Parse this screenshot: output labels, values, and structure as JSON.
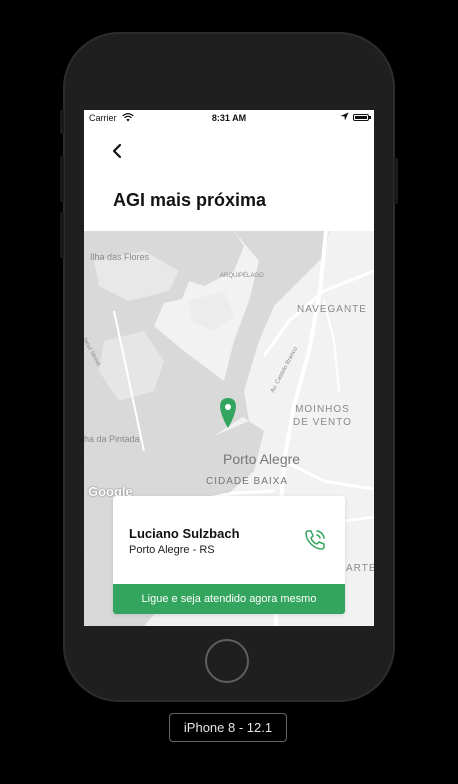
{
  "status_bar": {
    "carrier": "Carrier",
    "time": "8:31 AM"
  },
  "header": {
    "title": "AGI mais próxima"
  },
  "map": {
    "labels": {
      "ilha_das_flores": "Ilha das Flores",
      "arquipelago": "ARQUIPÉLAGO",
      "navegantes": "NAVEGANTE",
      "jacui_street": "Jacuí Street",
      "castelo_branco": "Av. Castelo Branco",
      "moinhos": "MOINHOS\nDE VENTO",
      "pintada": "ha da Pintada",
      "porto_alegre": "Porto Alegre",
      "cidade_baixa": "CIDADE BAIXA",
      "partial": "ARTE"
    },
    "attribution": "Google",
    "colors": {
      "water": "#d8d8d8",
      "land": "#f2f2f2",
      "pin": "#34a55e"
    }
  },
  "agent_card": {
    "name": "Luciano Sulzbach",
    "location": "Porto Alegre - RS",
    "cta_label": "Ligue e seja atendido agora mesmo",
    "accent": "#34a55e"
  },
  "device": {
    "label": "iPhone 8 - 12.1"
  }
}
